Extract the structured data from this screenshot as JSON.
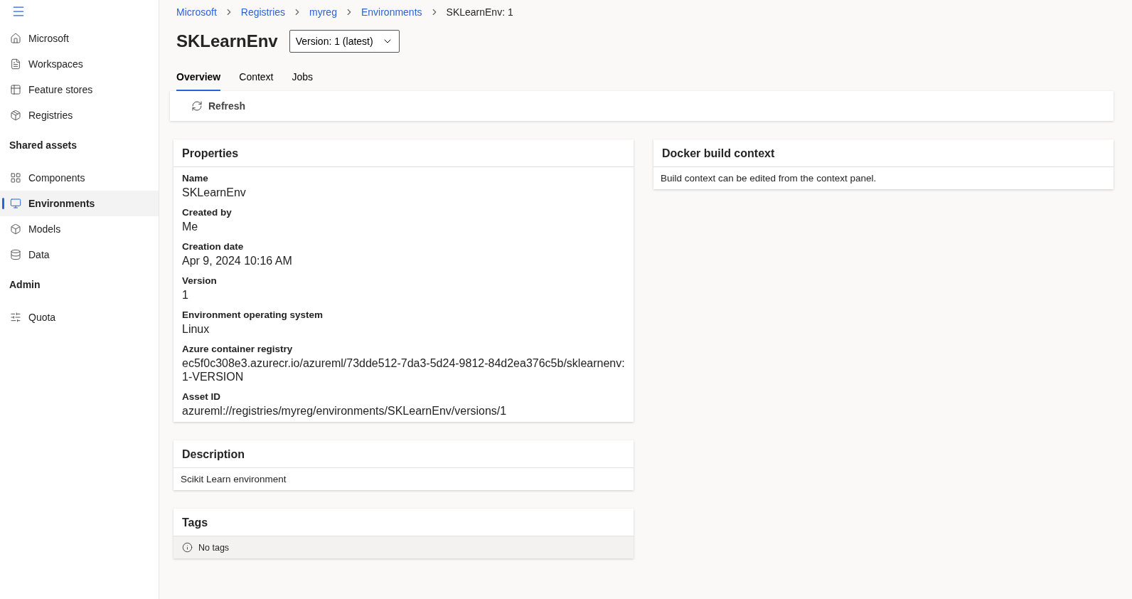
{
  "sidebar": {
    "top_items": [
      {
        "label": "Microsoft",
        "selected": false
      },
      {
        "label": "Workspaces",
        "selected": false
      },
      {
        "label": "Feature stores",
        "selected": false
      },
      {
        "label": "Registries",
        "selected": false
      }
    ],
    "sections": [
      {
        "heading": "Shared assets",
        "items": [
          {
            "label": "Components",
            "selected": false
          },
          {
            "label": "Environments",
            "selected": true
          },
          {
            "label": "Models",
            "selected": false
          },
          {
            "label": "Data",
            "selected": false
          }
        ]
      },
      {
        "heading": "Admin",
        "items": [
          {
            "label": "Quota",
            "selected": false
          }
        ]
      }
    ]
  },
  "breadcrumb": [
    {
      "label": "Microsoft",
      "current": false
    },
    {
      "label": "Registries",
      "current": false
    },
    {
      "label": "myreg",
      "current": false
    },
    {
      "label": "Environments",
      "current": false
    },
    {
      "label": "SKLearnEnv: 1",
      "current": true
    }
  ],
  "title": "SKLearnEnv",
  "version_dropdown": "Version: 1 (latest)",
  "tabs": [
    {
      "label": "Overview",
      "selected": true
    },
    {
      "label": "Context",
      "selected": false
    },
    {
      "label": "Jobs",
      "selected": false
    }
  ],
  "toolbar": {
    "refresh": "Refresh"
  },
  "properties": {
    "title": "Properties",
    "fields": [
      {
        "label": "Name",
        "value": "SKLearnEnv"
      },
      {
        "label": "Created by",
        "value": "Me"
      },
      {
        "label": "Creation date",
        "value": "Apr 9, 2024 10:16 AM"
      },
      {
        "label": "Version",
        "value": "1"
      },
      {
        "label": "Environment operating system",
        "value": "Linux"
      },
      {
        "label": "Azure container registry",
        "value": "ec5f0c308e3.azurecr.io/azureml/73dde512-7da3-5d24-9812-84d2ea376c5b/sklearnenv:1-VERSION"
      },
      {
        "label": "Asset ID",
        "value": "azureml://registries/myreg/environments/SKLearnEnv/versions/1"
      }
    ]
  },
  "description": {
    "title": "Description",
    "text": "Scikit Learn environment"
  },
  "tags": {
    "title": "Tags",
    "empty_text": "No tags"
  },
  "docker": {
    "title": "Docker build context",
    "text": "Build context can be edited from the context panel."
  }
}
